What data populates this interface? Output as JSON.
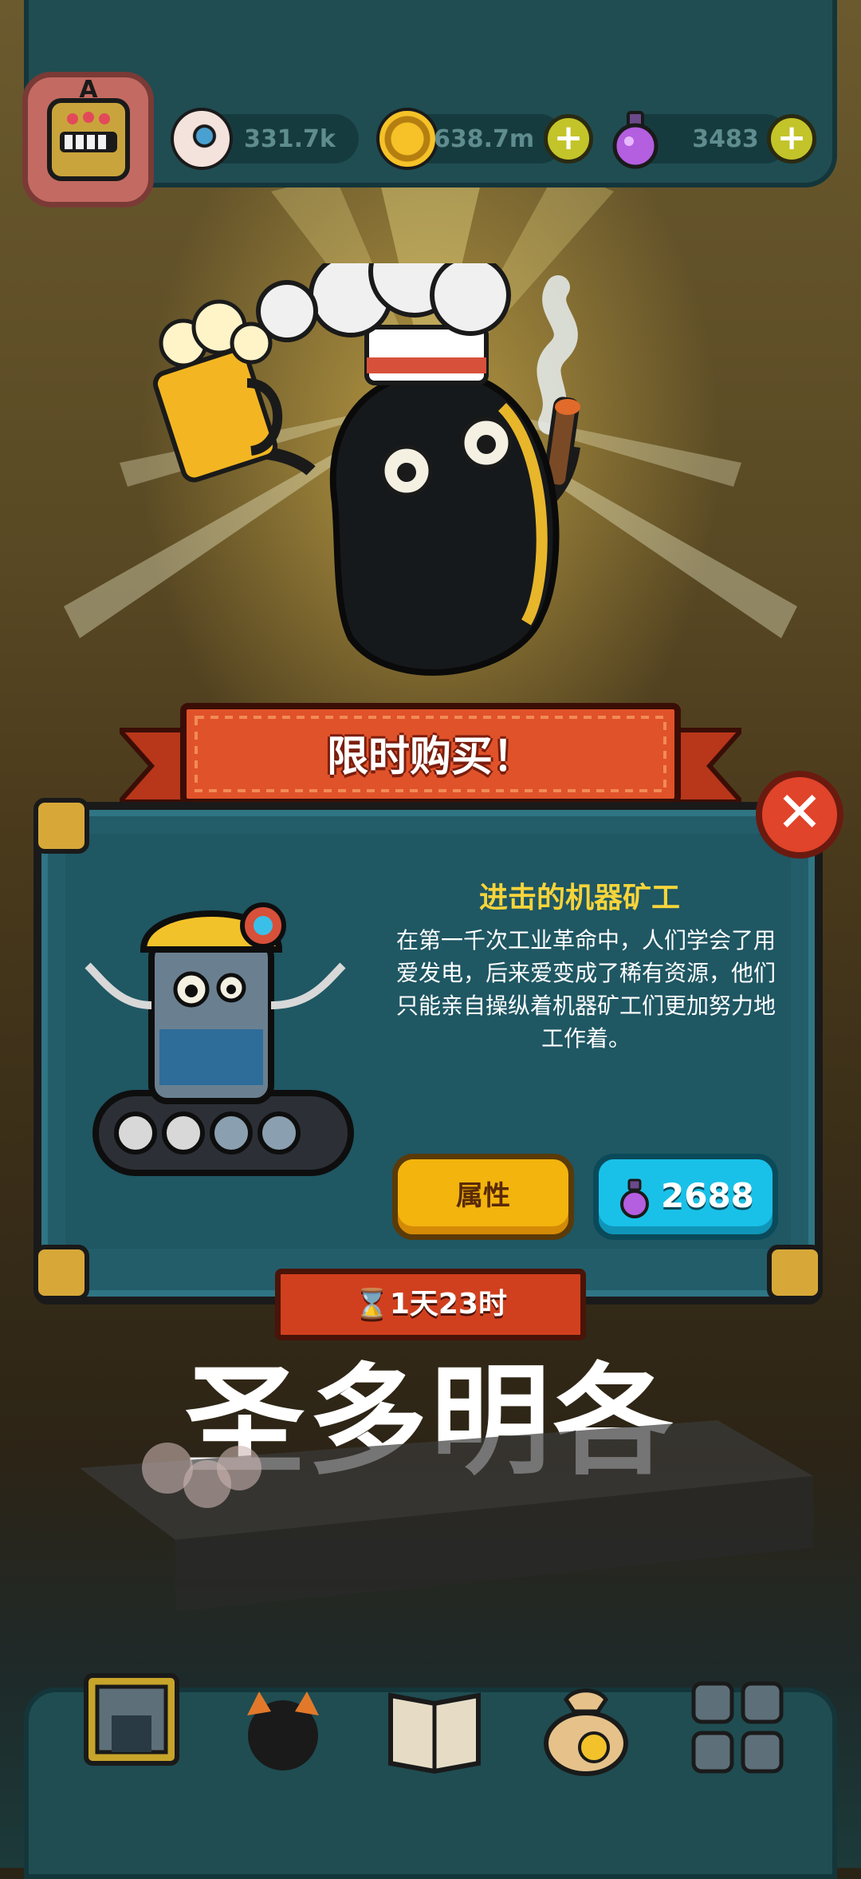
{
  "colors": {
    "panel": "#235d6a",
    "title_yellow": "#f7d43a",
    "banner_red": "#d1401e",
    "attr_button": "#f3b40e",
    "buy_button": "#19c1e8"
  },
  "resources": [
    {
      "icon": "eyeball-icon",
      "value": "331.7k",
      "has_plus": false
    },
    {
      "icon": "gold-coin-icon",
      "value": "638.7m",
      "has_plus": true
    },
    {
      "icon": "potion-icon",
      "value": "3483",
      "has_plus": true
    }
  ],
  "avatar": {
    "letter": "A"
  },
  "banner": {
    "title": "限时购买！"
  },
  "offer": {
    "name": "进击的机器矿工",
    "description": "在第一千次工业革命中，人们学会了用爱发电，后来爱变成了稀有资源，他们只能亲自操纵着机器矿工们更加努力地工作着。",
    "attr_button": "属性",
    "price": "2688",
    "timer": "⌛1天23时"
  },
  "watermark": "圣多明各",
  "nav": [
    {
      "icon": "mine-building-icon"
    },
    {
      "icon": "monster-icon"
    },
    {
      "icon": "book-icon"
    },
    {
      "icon": "money-bag-icon"
    },
    {
      "icon": "grid-menu-icon"
    }
  ]
}
